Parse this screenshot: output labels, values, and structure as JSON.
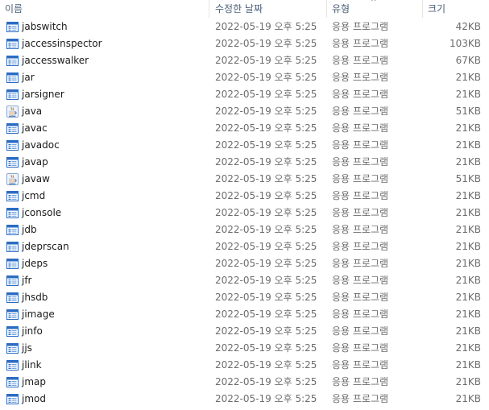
{
  "header": {
    "name": "이름",
    "date": "수정한 날짜",
    "type": "유형",
    "size": "크기",
    "sort_indicator": "^"
  },
  "files": [
    {
      "name": "jabswitch",
      "date": "2022-05-19 오후 5:25",
      "type": "응용 프로그램",
      "size": "42KB",
      "icon": "app-window-icon"
    },
    {
      "name": "jaccessinspector",
      "date": "2022-05-19 오후 5:25",
      "type": "응용 프로그램",
      "size": "103KB",
      "icon": "app-window-icon"
    },
    {
      "name": "jaccesswalker",
      "date": "2022-05-19 오후 5:25",
      "type": "응용 프로그램",
      "size": "67KB",
      "icon": "app-window-icon"
    },
    {
      "name": "jar",
      "date": "2022-05-19 오후 5:25",
      "type": "응용 프로그램",
      "size": "21KB",
      "icon": "app-window-icon"
    },
    {
      "name": "jarsigner",
      "date": "2022-05-19 오후 5:25",
      "type": "응용 프로그램",
      "size": "21KB",
      "icon": "app-window-icon"
    },
    {
      "name": "java",
      "date": "2022-05-19 오후 5:25",
      "type": "응용 프로그램",
      "size": "51KB",
      "icon": "java-coffee-icon"
    },
    {
      "name": "javac",
      "date": "2022-05-19 오후 5:25",
      "type": "응용 프로그램",
      "size": "21KB",
      "icon": "app-window-icon"
    },
    {
      "name": "javadoc",
      "date": "2022-05-19 오후 5:25",
      "type": "응용 프로그램",
      "size": "21KB",
      "icon": "app-window-icon"
    },
    {
      "name": "javap",
      "date": "2022-05-19 오후 5:25",
      "type": "응용 프로그램",
      "size": "21KB",
      "icon": "app-window-icon"
    },
    {
      "name": "javaw",
      "date": "2022-05-19 오후 5:25",
      "type": "응용 프로그램",
      "size": "51KB",
      "icon": "java-coffee-icon"
    },
    {
      "name": "jcmd",
      "date": "2022-05-19 오후 5:25",
      "type": "응용 프로그램",
      "size": "21KB",
      "icon": "app-window-icon"
    },
    {
      "name": "jconsole",
      "date": "2022-05-19 오후 5:25",
      "type": "응용 프로그램",
      "size": "21KB",
      "icon": "app-window-icon"
    },
    {
      "name": "jdb",
      "date": "2022-05-19 오후 5:25",
      "type": "응용 프로그램",
      "size": "21KB",
      "icon": "app-window-icon"
    },
    {
      "name": "jdeprscan",
      "date": "2022-05-19 오후 5:25",
      "type": "응용 프로그램",
      "size": "21KB",
      "icon": "app-window-icon"
    },
    {
      "name": "jdeps",
      "date": "2022-05-19 오후 5:25",
      "type": "응용 프로그램",
      "size": "21KB",
      "icon": "app-window-icon"
    },
    {
      "name": "jfr",
      "date": "2022-05-19 오후 5:25",
      "type": "응용 프로그램",
      "size": "21KB",
      "icon": "app-window-icon"
    },
    {
      "name": "jhsdb",
      "date": "2022-05-19 오후 5:25",
      "type": "응용 프로그램",
      "size": "21KB",
      "icon": "app-window-icon"
    },
    {
      "name": "jimage",
      "date": "2022-05-19 오후 5:25",
      "type": "응용 프로그램",
      "size": "21KB",
      "icon": "app-window-icon"
    },
    {
      "name": "jinfo",
      "date": "2022-05-19 오후 5:25",
      "type": "응용 프로그램",
      "size": "21KB",
      "icon": "app-window-icon"
    },
    {
      "name": "jjs",
      "date": "2022-05-19 오후 5:25",
      "type": "응용 프로그램",
      "size": "21KB",
      "icon": "app-window-icon"
    },
    {
      "name": "jlink",
      "date": "2022-05-19 오후 5:25",
      "type": "응용 프로그램",
      "size": "21KB",
      "icon": "app-window-icon"
    },
    {
      "name": "jmap",
      "date": "2022-05-19 오후 5:25",
      "type": "응용 프로그램",
      "size": "21KB",
      "icon": "app-window-icon"
    },
    {
      "name": "jmod",
      "date": "2022-05-19 오후 5:25",
      "type": "응용 프로그램",
      "size": "21KB",
      "icon": "app-window-icon"
    }
  ],
  "colors": {
    "header_text": "#4c607a",
    "name_text": "#1a1a1a",
    "meta_text": "#6d6d6d",
    "app_icon_blue": "#2b6cc4",
    "java_cup_orange": "#e76f00"
  }
}
